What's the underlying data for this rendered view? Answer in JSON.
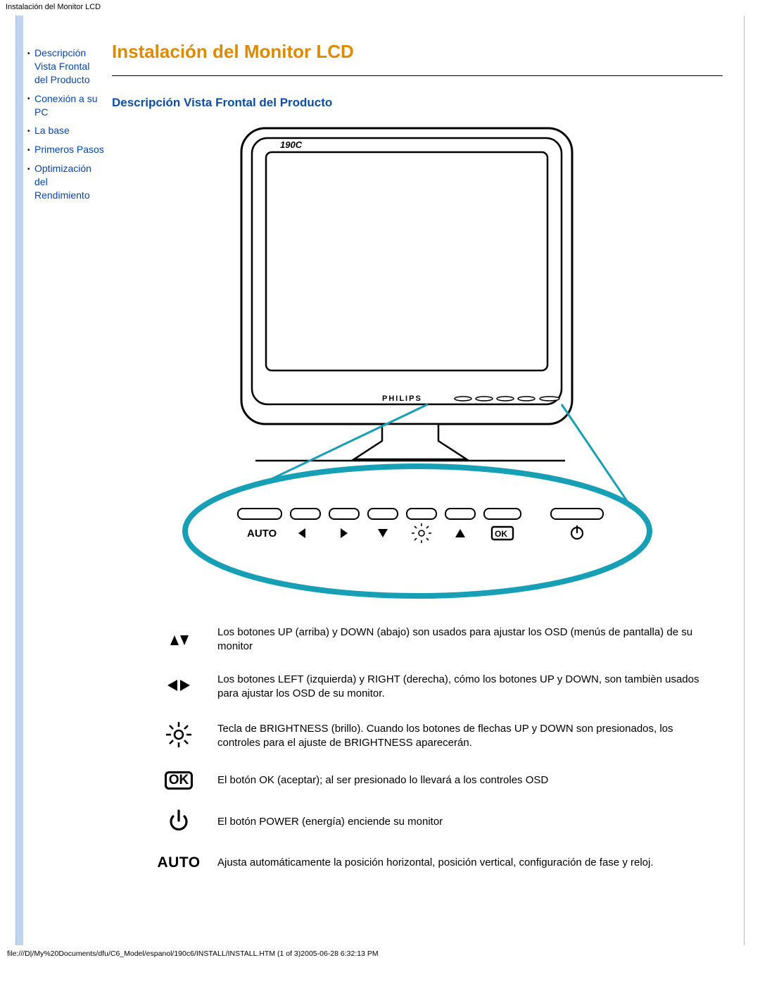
{
  "header": "Instalación del Monitor LCD",
  "footer": "file:///D|/My%20Documents/dfu/C6_Model/espanol/190c6/INSTALL/INSTALL.HTM (1 of 3)2005-06-28 6:32:13 PM",
  "title": "Instalación del Monitor LCD",
  "section_heading": "Descripción Vista Frontal del Producto",
  "sidebar": {
    "items": [
      {
        "label": "Descripción Vista Frontal del Producto"
      },
      {
        "label": "Conexión a su PC"
      },
      {
        "label": "La base"
      },
      {
        "label": "Primeros Pasos"
      },
      {
        "label": "Optimización del Rendimiento"
      }
    ]
  },
  "monitor": {
    "model_label": "190C",
    "brand_label": "PHILIPS",
    "button_auto_label": "AUTO"
  },
  "legend": [
    {
      "icon_name": "up-down-icon",
      "desc": "Los botones UP (arriba) y DOWN (abajo) son usados para ajustar los OSD (menús de pantalla) de su monitor"
    },
    {
      "icon_name": "left-right-icon",
      "desc": "Los botones LEFT (izquierda) y RIGHT (derecha), cómo los botones UP y DOWN, son tambièn usados para ajustar los OSD de su monitor."
    },
    {
      "icon_name": "brightness-icon",
      "desc": "Tecla de BRIGHTNESS (brillo). Cuando los botones de flechas UP y DOWN son presionados, los controles para el ajuste de BRIGHTNESS aparecerán."
    },
    {
      "icon_name": "ok-icon",
      "desc": "El botón OK (aceptar); al ser presionado lo llevará a los controles OSD"
    },
    {
      "icon_name": "power-icon",
      "desc": "El botón POWER (energía) enciende su monitor"
    },
    {
      "icon_name": "auto-icon",
      "auto_label": "AUTO",
      "desc": "Ajusta automáticamente la posición horizontal, posición vertical, configuración de fase y reloj."
    }
  ]
}
